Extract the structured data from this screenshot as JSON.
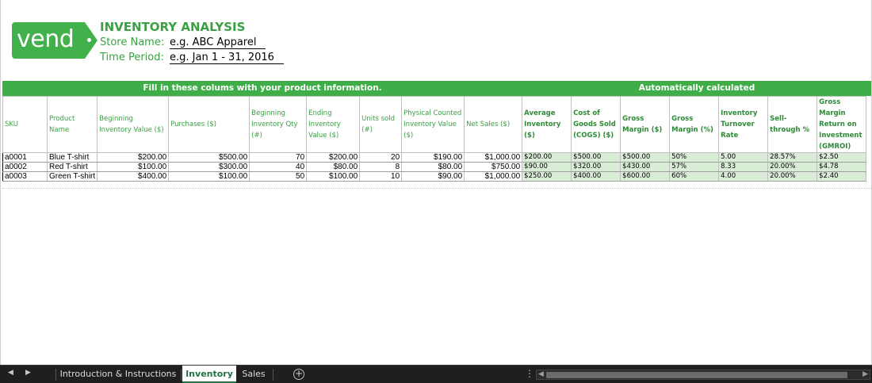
{
  "header": {
    "logo_text": "vend",
    "title": "INVENTORY ANALYSIS",
    "store_label": "Store Name:",
    "store_value": "e.g. ABC Apparel",
    "period_label": "Time Period:",
    "period_value": "e.g. Jan 1 - 31, 2016"
  },
  "banner": {
    "left": "Fill in these colums with your product information.",
    "right": "Automatically calculated"
  },
  "table": {
    "headers": [
      "SKU",
      "Product Name",
      "Beginning Inventory Value ($)",
      "Purchases ($)",
      "Beginning Inventory Qty (#)",
      "Ending Inventory Value ($)",
      "Units sold (#)",
      "Physical Counted Inventory Value ($)",
      "Net Sales ($)",
      "Average Inventory ($)",
      "Cost of Goods Sold (COGS) ($)",
      "Gross Margin ($)",
      "Gross Margin (%)",
      "Inventory Turnover Rate",
      "Sell-through %",
      "Gross Margin Return on Investment (GMROI)"
    ],
    "rows": [
      [
        "a0001",
        "Blue T-shirt",
        "$200.00",
        "$500.00",
        "70",
        "$200.00",
        "20",
        "$190.00",
        "$1,000.00",
        "$200.00",
        "$500.00",
        "$500.00",
        "50%",
        "5.00",
        "28.57%",
        "$2.50"
      ],
      [
        "a0002",
        "Red T-shirt",
        "$100.00",
        "$300.00",
        "40",
        "$80.00",
        "8",
        "$80.00",
        "$750.00",
        "$90.00",
        "$320.00",
        "$430.00",
        "57%",
        "8.33",
        "20.00%",
        "$4.78"
      ],
      [
        "a0003",
        "Green T-shirt",
        "$400.00",
        "$100.00",
        "50",
        "$100.00",
        "10",
        "$90.00",
        "$1,000.00",
        "$250.00",
        "$400.00",
        "$600.00",
        "60%",
        "4.00",
        "20.00%",
        "$2.40"
      ]
    ]
  },
  "tabs": {
    "nav_prev": "◀",
    "nav_next": "▶",
    "items": [
      "Introduction & Instructions",
      "Inventory",
      "Sales"
    ],
    "active": "Inventory",
    "add": "+",
    "more": "⋮"
  },
  "colors": {
    "brand_green": "#41b24b",
    "header_text_green": "#3aa043",
    "calculated_fill": "#d9ecd6",
    "tab_active": "#217346"
  }
}
